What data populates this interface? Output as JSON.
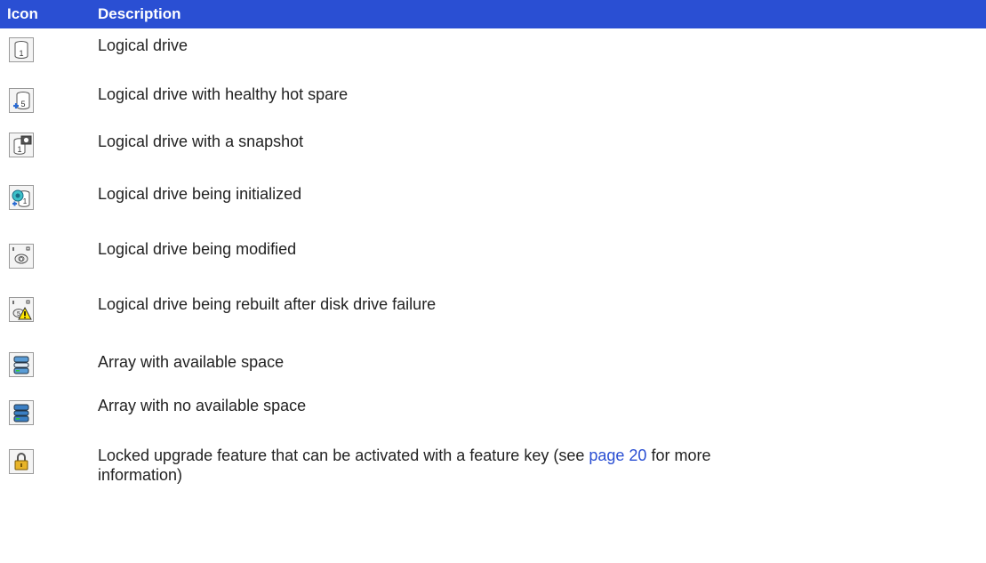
{
  "header": {
    "col_icon": "Icon",
    "col_description": "Description"
  },
  "rows": [
    {
      "icon": "logical-drive-icon",
      "text": "Logical drive"
    },
    {
      "icon": "logical-drive-hot-spare-icon",
      "text": "Logical drive with healthy hot spare"
    },
    {
      "icon": "logical-drive-snapshot-icon",
      "text": "Logical drive with a snapshot"
    },
    {
      "icon": "logical-drive-initializing-icon",
      "text": "Logical drive being initialized"
    },
    {
      "icon": "logical-drive-modifying-icon",
      "text": "Logical drive being modified"
    },
    {
      "icon": "logical-drive-rebuilding-icon",
      "text": "Logical drive being rebuilt after disk drive failure"
    },
    {
      "icon": "array-available-space-icon",
      "text": "Array with available space"
    },
    {
      "icon": "array-no-space-icon",
      "text": "Array with no available space"
    },
    {
      "icon": "lock-icon",
      "text_before": "Locked upgrade feature that can be activated with a feature key (see ",
      "link": "page 20",
      "text_after": " for more",
      "text_line2": "information)"
    }
  ],
  "colors": {
    "header_bg": "#2a4fd3",
    "link": "#2a4fd3"
  }
}
